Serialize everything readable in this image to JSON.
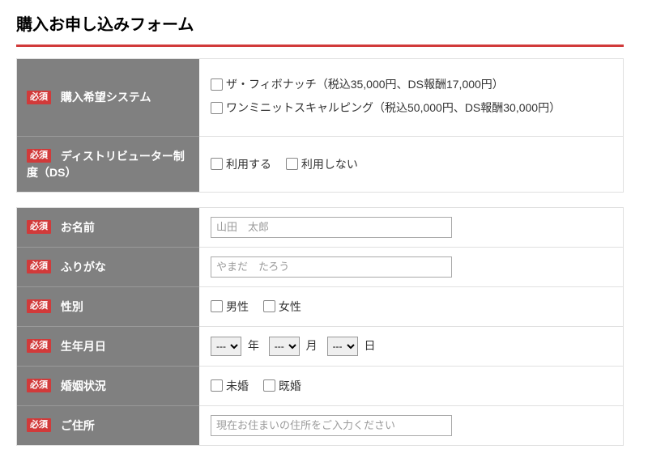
{
  "title": "購入お申し込みフォーム",
  "req_label": "必須",
  "fields": {
    "system": {
      "label": "購入希望システム",
      "options": [
        "ザ・フィボナッチ（税込35,000円、DS報酬17,000円）",
        "ワンミニットスキャルピング（税込50,000円、DS報酬30,000円）"
      ]
    },
    "ds": {
      "label": "ディストリビューター制度（DS）",
      "options": [
        "利用する",
        "利用しない"
      ]
    },
    "name": {
      "label": "お名前",
      "placeholder": "山田　太郎"
    },
    "furigana": {
      "label": "ふりがな",
      "placeholder": "やまだ　たろう"
    },
    "gender": {
      "label": "性別",
      "options": [
        "男性",
        "女性"
      ]
    },
    "birth": {
      "label": "生年月日",
      "select_default": "---",
      "year": "年",
      "month": "月",
      "day": "日"
    },
    "marital": {
      "label": "婚姻状況",
      "options": [
        "未婚",
        "既婚"
      ]
    },
    "address": {
      "label": "ご住所",
      "placeholder": "現在お住まいの住所をご入力ください"
    }
  }
}
